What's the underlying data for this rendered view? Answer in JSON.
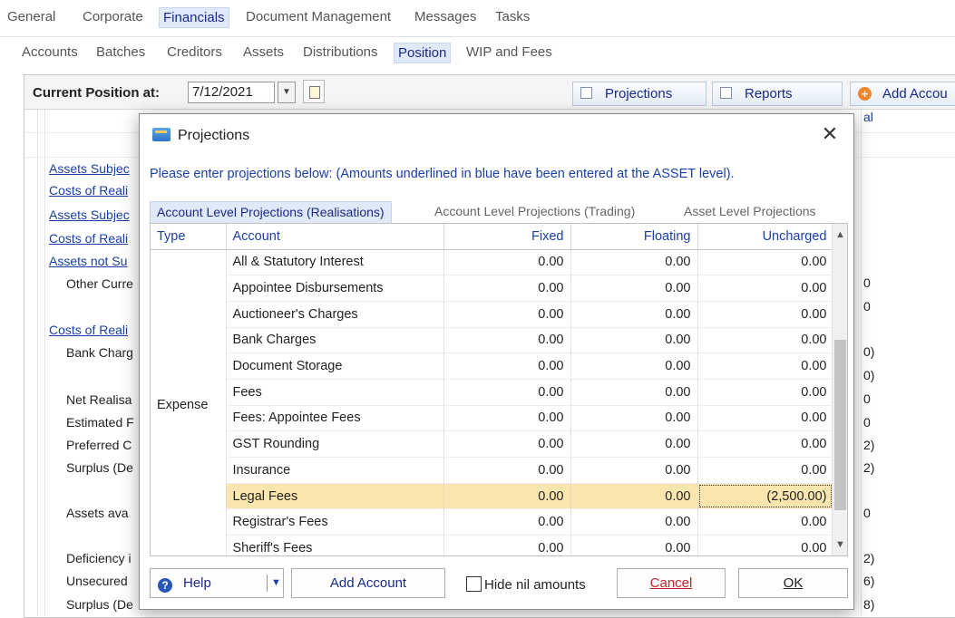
{
  "top_tabs": [
    "General",
    "Corporate",
    "Financials",
    "Document Management",
    "Messages",
    "Tasks"
  ],
  "sub_tabs": [
    "Accounts",
    "Batches",
    "Creditors",
    "Assets",
    "Distributions",
    "Position",
    "WIP and Fees"
  ],
  "toolbar": {
    "position_label": "Current Position at:",
    "date_value": "7/12/2021",
    "projections_label": "Projections",
    "reports_label": "Reports",
    "add_account_label": "Add Accou"
  },
  "background": {
    "header_fragment": "al",
    "rows": [
      "Assets Subjec",
      "Costs of Reali",
      "Assets Subjec",
      "Costs of Reali",
      "Assets not Su",
      "Other Curre",
      "Costs of Reali",
      "Bank Charg",
      "Net Realisa",
      "Estimated F",
      "Preferred C",
      "Surplus (De",
      "Assets ava",
      "Deficiency i",
      "Unsecured",
      "Surplus (De"
    ],
    "right_values": [
      "0",
      "0",
      "0)",
      "0)",
      "0",
      "0",
      "2)",
      "2)",
      "0",
      "2)",
      "6)",
      "8)"
    ]
  },
  "dialog": {
    "title": "Projections",
    "message": "Please enter projections below:   (Amounts underlined in blue have been entered at the ASSET level).",
    "tabs": [
      "Account Level Projections (Realisations)",
      "Account Level Projections (Trading)",
      "Asset Level Projections"
    ],
    "columns": [
      "Type",
      "Account",
      "Fixed",
      "Floating",
      "Uncharged"
    ],
    "type_value": "Expense",
    "rows": [
      {
        "account": "All & Statutory Interest",
        "fixed": "0.00",
        "floating": "0.00",
        "uncharged": "0.00"
      },
      {
        "account": "Appointee Disbursements",
        "fixed": "0.00",
        "floating": "0.00",
        "uncharged": "0.00"
      },
      {
        "account": "Auctioneer's Charges",
        "fixed": "0.00",
        "floating": "0.00",
        "uncharged": "0.00"
      },
      {
        "account": "Bank Charges",
        "fixed": "0.00",
        "floating": "0.00",
        "uncharged": "0.00"
      },
      {
        "account": "Document Storage",
        "fixed": "0.00",
        "floating": "0.00",
        "uncharged": "0.00"
      },
      {
        "account": "Fees",
        "fixed": "0.00",
        "floating": "0.00",
        "uncharged": "0.00"
      },
      {
        "account": "Fees: Appointee Fees",
        "fixed": "0.00",
        "floating": "0.00",
        "uncharged": "0.00"
      },
      {
        "account": "GST Rounding",
        "fixed": "0.00",
        "floating": "0.00",
        "uncharged": "0.00"
      },
      {
        "account": "Insurance",
        "fixed": "0.00",
        "floating": "0.00",
        "uncharged": "0.00"
      },
      {
        "account": "Legal Fees",
        "fixed": "0.00",
        "floating": "0.00",
        "uncharged": "(2,500.00)"
      },
      {
        "account": "Registrar's Fees",
        "fixed": "0.00",
        "floating": "0.00",
        "uncharged": "0.00"
      },
      {
        "account": "Sheriff's Fees",
        "fixed": "0.00",
        "floating": "0.00",
        "uncharged": "0.00"
      }
    ],
    "footer": {
      "help_label": "Help",
      "add_account_label": "Add Account",
      "hide_nil_label": "Hide nil amounts",
      "cancel_label": "Cancel",
      "ok_label": "OK"
    }
  }
}
